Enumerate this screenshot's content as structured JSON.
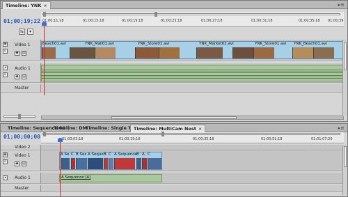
{
  "top_panel": {
    "tab_title": "Timeline: YNK",
    "tab_close": "×",
    "current_time": "01;00;19;22",
    "ruler_labels": [
      "01;00;11;18",
      "01;00;15;18",
      "01;00;19;18",
      "01;00;23;18",
      "01;00;27;18",
      "01;00;31;18",
      "01;00;35;18",
      "01;00;39"
    ],
    "tracks": {
      "video": "Video 1",
      "audio": "Audio 1",
      "master": "Master"
    },
    "clips": [
      "Beach01.avi",
      "YNK_Mall01.avi",
      "YNK_Store01.avi",
      "YNK_Market02.avi",
      "YNK_Store01.avi",
      "YNK_Beach01.avi"
    ]
  },
  "bottom_panel": {
    "tabs": [
      "Timeline: Sequence 01",
      "Timeline: DM",
      "Timeline: Single Track",
      "Timeline: MultiCam Nest"
    ],
    "tab_close": "×",
    "current_time": "01;00;00;00",
    "ruler_labels": [
      "01;00;03;18",
      "01;00;19;18",
      "01;00;35;18",
      "01;00;51;18",
      "01;01;07;20"
    ],
    "tracks": {
      "video2": "Video 2",
      "video1": "Video 1",
      "audio": "Audio 1",
      "master": "Master"
    },
    "mc_labels": [
      "A Se",
      "C",
      "B Ses",
      "A Seque",
      "B",
      "C",
      "A Sequence",
      "B",
      "A",
      "C"
    ],
    "audio_clip": "A Sequence [A]"
  },
  "colors": {
    "timecode": "#1f56b8",
    "video_clip": "#a7cfe6",
    "audio_clip": "#a9c8a0",
    "playhead": "#dd2222"
  }
}
